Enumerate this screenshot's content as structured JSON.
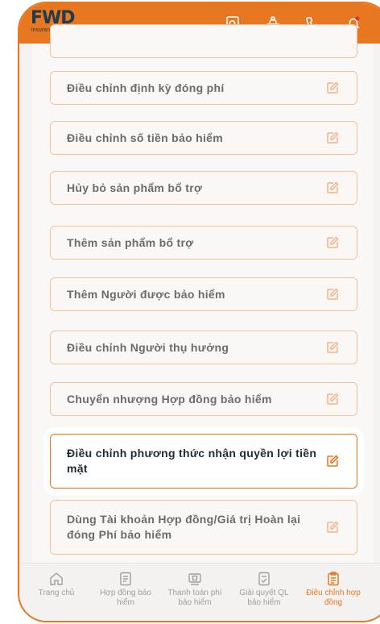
{
  "header": {
    "logo_text": "FWD",
    "logo_sub": "insurance",
    "icons": [
      "search-document-icon",
      "family-icon",
      "phone-icon",
      "notification-bell-icon",
      "settings-icon"
    ]
  },
  "cards": [
    {
      "label": ""
    },
    {
      "label": "Điều chỉnh định kỳ đóng phí"
    },
    {
      "label": "Điều chỉnh số tiền bảo hiểm"
    },
    {
      "label": "Hủy bỏ sản phẩm bổ trợ"
    },
    {
      "label": "Thêm sản phẩm bổ trợ"
    },
    {
      "label": "Thêm Người được bảo hiểm"
    },
    {
      "label": "Điều chỉnh Người thụ hưởng"
    },
    {
      "label": "Chuyển nhượng Hợp đồng bảo hiểm"
    },
    {
      "label": "Điều chỉnh phương thức nhận quyền lợi tiền mặt"
    },
    {
      "label": "Dùng Tài khoản Hợp đồng/Giá trị Hoàn lại đóng Phí bảo hiểm"
    }
  ],
  "tabs": [
    {
      "label": "Trang chủ",
      "icon": "home-icon"
    },
    {
      "label": "Hợp đồng bảo hiểm",
      "icon": "contract-icon"
    },
    {
      "label": "Thanh toán phí bảo hiểm",
      "icon": "payment-icon"
    },
    {
      "label": "Giải quyết QL bảo hiểm",
      "icon": "claim-icon"
    },
    {
      "label": "Điều chỉnh hợp đồng",
      "icon": "adjust-contract-icon",
      "active": true
    }
  ],
  "colors": {
    "brand": "#e87722",
    "navy": "#1f3b4d",
    "card_border": "#f3c29c"
  }
}
